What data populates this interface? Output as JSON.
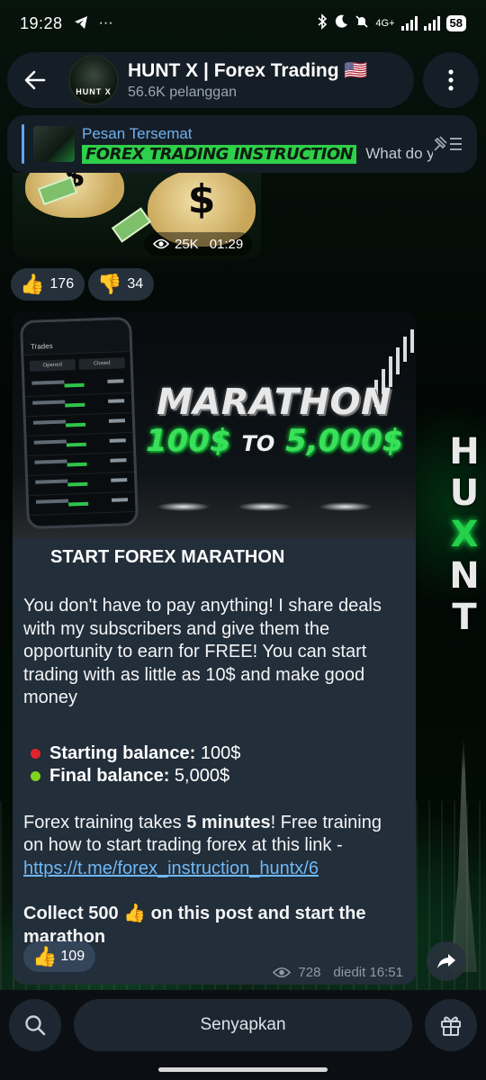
{
  "status_bar": {
    "time": "19:28",
    "network_label": "4G+",
    "battery": "58"
  },
  "header": {
    "title": "HUNT X | Forex Trading 🇺🇸",
    "subtitle": "56.6K pelanggan",
    "avatar_label": "HUNT X"
  },
  "pinned": {
    "label": "Pesan Tersemat",
    "preview_highlight": "FOREX TRADING INSTRUCTION",
    "preview_text": "What do y..."
  },
  "previous_post": {
    "views": "25K",
    "time": "01:29",
    "reactions": [
      {
        "emoji": "👍",
        "count": "176"
      },
      {
        "emoji": "👎",
        "count": "34"
      }
    ]
  },
  "post": {
    "banner": {
      "title": "MARATHON",
      "amount_from": "100$",
      "to_word": "TO",
      "amount_to": "5,000$",
      "phone_header": "Trades",
      "phone_tab_opened": "Opened",
      "phone_tab_closed": "Closed"
    },
    "heading": "START FOREX MARATHON",
    "paragraph1": "You don't have to pay anything! I share deals with my subscribers and give them the opportunity to earn for FREE! You can start trading with as little as 10$ and make good money",
    "starting_label": "Starting balance:",
    "starting_value": " 100$",
    "final_label": "Final balance:",
    "final_value": " 5,000$",
    "training_prefix": "Forex training takes ",
    "training_bold": "5 minutes",
    "training_suffix": "! Free training on how to start trading forex at this link - ",
    "link": "https://t.me/forex_instruction_huntx/6",
    "collect_text": "Collect 500 👍 on this post and start the marathon",
    "reaction": {
      "emoji": "👍",
      "count": "109"
    },
    "views": "728",
    "edited_time": "diedit 16:51"
  },
  "bottom_bar": {
    "mute_label": "Senyapkan"
  },
  "wallpaper_letters": [
    "H",
    "U",
    "X",
    "N",
    "T"
  ],
  "colors": {
    "accent": "#6fb2f0",
    "link": "#6fb8f5",
    "bubble": "#222e3a",
    "neon_green": "#2ecf4a",
    "dot_red": "#e0242c",
    "dot_green": "#7ed321"
  }
}
